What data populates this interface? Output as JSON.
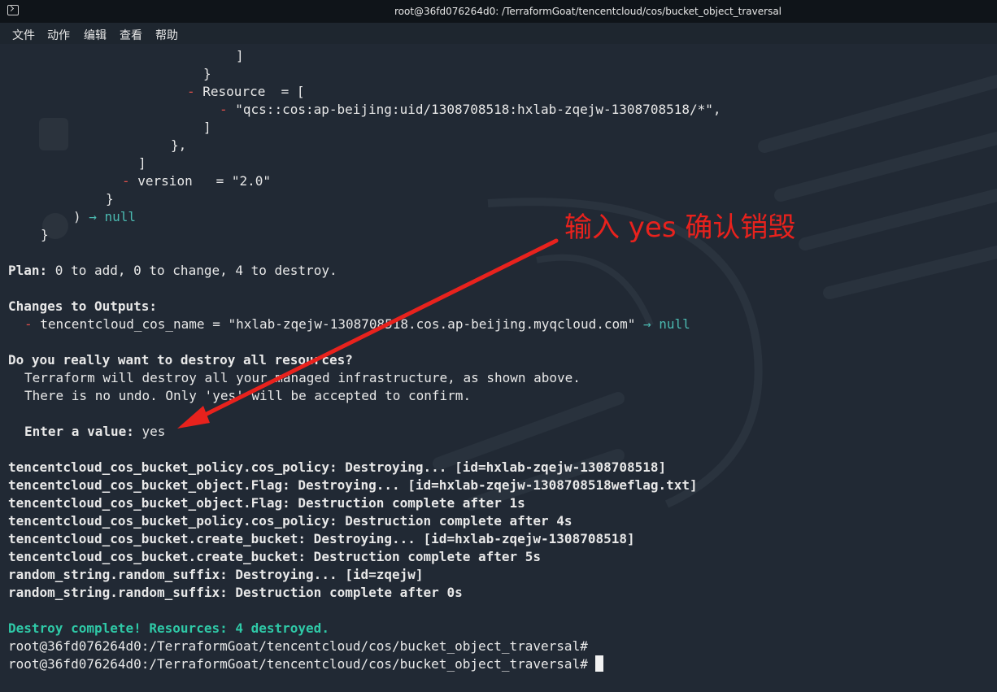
{
  "window": {
    "title": "root@36fd076264d0: /TerraformGoat/tencentcloud/cos/bucket_object_traversal"
  },
  "menu": {
    "items": [
      "文件",
      "动作",
      "编辑",
      "查看",
      "帮助"
    ]
  },
  "terminal": {
    "lines": {
      "l1": "]",
      "l2": "}",
      "l3_marker": "-",
      "l3_text": " Resource  = [",
      "l4_marker": "-",
      "l4_text": " \"qcs::cos:ap-beijing:uid/1308708518:hxlab-zqejw-1308708518/*\",",
      "l5": "]",
      "l6": "},",
      "l7": "]",
      "l8_marker": "-",
      "l8_text": " version   = \"2.0\"",
      "l9": "}",
      "l10_text": ") ",
      "l10_arrow": "→ null",
      "l11": "}",
      "plan_label": "Plan:",
      "plan_text": " 0 to add, 0 to change, 4 to destroy.",
      "changes_outputs": "Changes to Outputs:",
      "out_marker": "-",
      "out_text": " tencentcloud_cos_name = \"hxlab-zqejw-1308708518.cos.ap-beijing.myqcloud.com\" ",
      "out_arrow": "→ null",
      "question": "Do you really want to destroy all resources?",
      "warn1": "Terraform will destroy all your managed infrastructure, as shown above.",
      "warn2": "There is no undo. Only 'yes' will be accepted to confirm.",
      "enter_label": "Enter a value:",
      "enter_value": " yes",
      "d1": "tencentcloud_cos_bucket_policy.cos_policy: Destroying... [id=hxlab-zqejw-1308708518]",
      "d2": "tencentcloud_cos_bucket_object.Flag: Destroying... [id=hxlab-zqejw-1308708518weflag.txt]",
      "d3": "tencentcloud_cos_bucket_object.Flag: Destruction complete after 1s",
      "d4": "tencentcloud_cos_bucket_policy.cos_policy: Destruction complete after 4s",
      "d5": "tencentcloud_cos_bucket.create_bucket: Destroying... [id=hxlab-zqejw-1308708518]",
      "d6": "tencentcloud_cos_bucket.create_bucket: Destruction complete after 5s",
      "d7": "random_string.random_suffix: Destroying... [id=zqejw]",
      "d8": "random_string.random_suffix: Destruction complete after 0s",
      "complete": "Destroy complete! Resources: 4 destroyed.",
      "prompt1": "root@36fd076264d0:/TerraformGoat/tencentcloud/cos/bucket_object_traversal#",
      "prompt2": "root@36fd076264d0:/TerraformGoat/tencentcloud/cos/bucket_object_traversal# "
    }
  },
  "annotation": {
    "text": "输入 yes 确认销毁",
    "color": "#e8221d"
  },
  "colors": {
    "background": "#212934",
    "removed_marker": "#e0504b",
    "null_arrow": "#4bb9b0",
    "success": "#2fc9a7"
  }
}
